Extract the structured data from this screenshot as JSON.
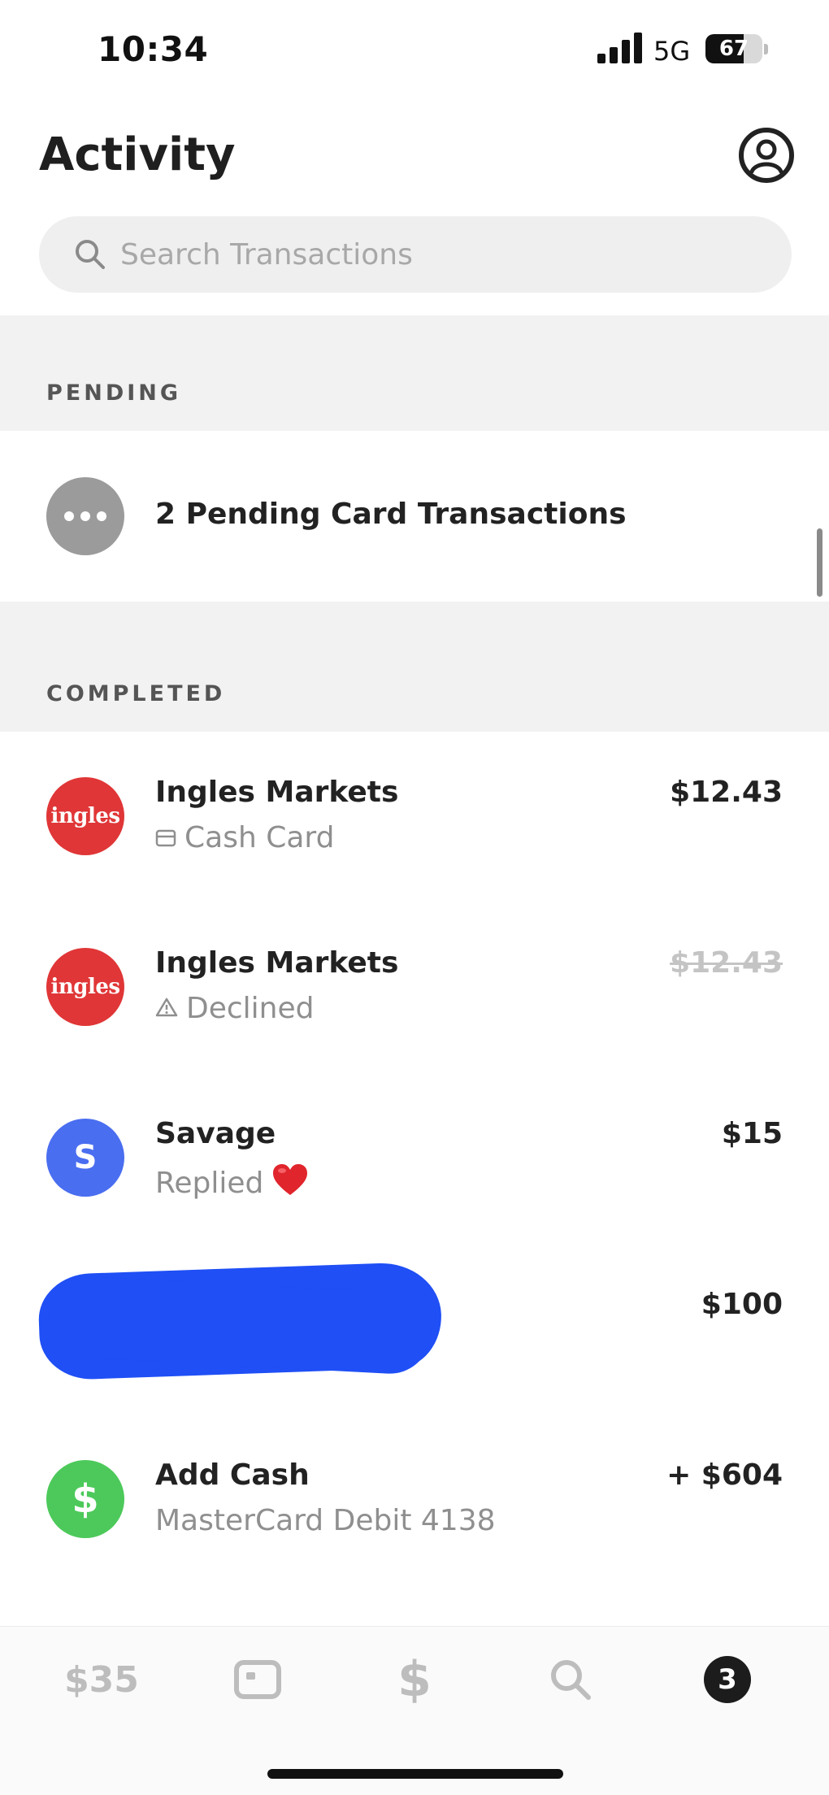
{
  "status_bar": {
    "time": "10:34",
    "network": "5G",
    "battery": "67",
    "battery_level_percent": 67
  },
  "header": {
    "title": "Activity",
    "profile_icon": "profile-circle-icon"
  },
  "search": {
    "placeholder": "Search Transactions",
    "value": "",
    "icon": "search-icon"
  },
  "pending": {
    "label": "PENDING",
    "item": {
      "title": "2 Pending Card Transactions",
      "icon": "more-dots-icon"
    }
  },
  "completed": {
    "label": "COMPLETED",
    "items": [
      {
        "avatar_text": "ingles",
        "title": "Ingles Markets",
        "subtitle": "Cash Card",
        "subtitle_icon": "card-icon",
        "amount": "$12.43",
        "struck": false,
        "avatar_color": "#e03637"
      },
      {
        "avatar_text": "ingles",
        "title": "Ingles Markets",
        "subtitle": "Declined",
        "subtitle_icon": "warning-icon",
        "amount": "$12.43",
        "struck": true,
        "avatar_color": "#e03637"
      },
      {
        "avatar_text": "S",
        "title": "Savage",
        "subtitle": "Replied",
        "subtitle_icon": "heart-icon",
        "amount": "$15",
        "struck": false,
        "avatar_color": "#4a6ef0"
      },
      {
        "avatar_text": "",
        "title": "",
        "subtitle": "",
        "amount": "$100",
        "redacted": true
      },
      {
        "avatar_text": "$",
        "title": "Add Cash",
        "subtitle": "MasterCard Debit 4138",
        "amount": "+ $604",
        "struck": false,
        "avatar_color": "#4cc95a"
      }
    ]
  },
  "tab_bar": {
    "balance": "$35",
    "card_icon": "cash-card-icon",
    "pay_icon": "dollar-icon",
    "pay_symbol": "$",
    "search_icon": "search-icon",
    "activity_badge": "3"
  },
  "colors": {
    "redaction": "#1f4ff5",
    "section_bg": "#f2f2f2"
  }
}
